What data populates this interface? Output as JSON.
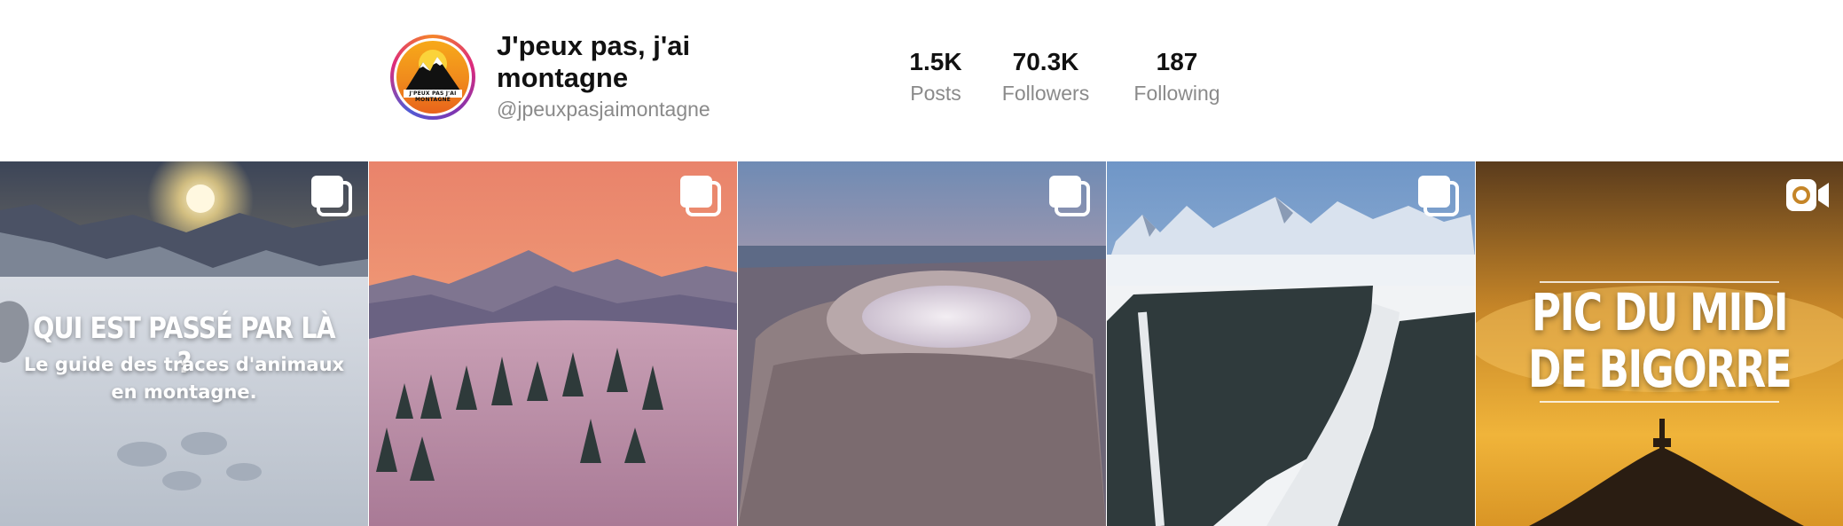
{
  "profile": {
    "name": "J'peux pas, j'ai montagne",
    "handle": "@jpeuxpasjaimontagne",
    "avatar_text": "J'PEUX PAS J'AI MONTAGNE"
  },
  "stats": {
    "posts": {
      "value": "1.5K",
      "label": "Posts"
    },
    "followers": {
      "value": "70.3K",
      "label": "Followers"
    },
    "following": {
      "value": "187",
      "label": "Following"
    }
  },
  "posts": [
    {
      "type": "carousel",
      "icon": "multiple-posts-icon",
      "overlay_title": "QUI EST PASSÉ PAR LÀ ?",
      "overlay_subtitle": "Le guide des traces d'animaux en montagne."
    },
    {
      "type": "carousel",
      "icon": "multiple-posts-icon"
    },
    {
      "type": "carousel",
      "icon": "multiple-posts-icon"
    },
    {
      "type": "carousel",
      "icon": "multiple-posts-icon"
    },
    {
      "type": "video",
      "icon": "video-camera-icon",
      "overlay_title_line1": "PIC DU MIDI",
      "overlay_title_line2": "DE BIGORRE"
    }
  ],
  "colors": {
    "muted_text": "#8a8a8a",
    "primary_text": "#111111",
    "ring_gradient": [
      "#f58529",
      "#dd2a7b",
      "#8134af"
    ]
  }
}
